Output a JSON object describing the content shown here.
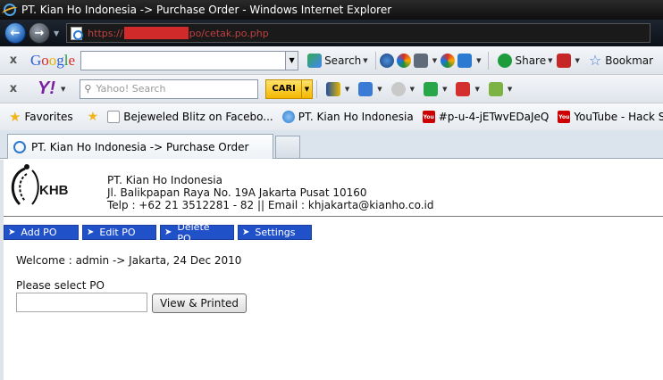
{
  "window": {
    "title": "PT. Kian Ho Indonesia -> Purchase Order - Windows Internet Explorer"
  },
  "address": {
    "prefix": "https://",
    "suffix": "po/cetak.po.php"
  },
  "google_toolbar": {
    "close": "x",
    "logo": "Google",
    "search_label": "Search",
    "share_label": "Share",
    "bookmarks_label": "Bookmar"
  },
  "yahoo_toolbar": {
    "close": "x",
    "logo": "Y!",
    "search_placeholder": "Yahoo! Search",
    "cari_label": "CARI"
  },
  "favorites": {
    "label": "Favorites",
    "items": [
      {
        "label": "Bejeweled Blitz on Facebo...",
        "icon": "page-icon"
      },
      {
        "label": "PT. Kian Ho Indonesia",
        "icon": "ie-icon"
      },
      {
        "label": "#p-u-4-jETwvEDaJeQ",
        "icon": "youtube-icon"
      },
      {
        "label": "YouTube - Hack Shutdow...",
        "icon": "youtube-icon"
      }
    ]
  },
  "tab": {
    "label": "PT. Kian Ho Indonesia -> Purchase Order"
  },
  "company": {
    "logo_text": "KHB",
    "name": "PT. Kian Ho Indonesia",
    "address": "Jl. Balikpapan Raya No. 19A Jakarta Pusat 10160",
    "contact": "Telp : +62 21 3512281 - 82 || Email : khjakarta@kianho.co.id"
  },
  "menu": {
    "items": [
      "Add PO",
      "Edit PO",
      "Delete PO",
      "Settings"
    ]
  },
  "main": {
    "welcome": "Welcome : admin -> Jakarta, 24 Dec 2010",
    "select_label": "Please select PO",
    "po_value": "",
    "view_button": "View & Printed"
  }
}
